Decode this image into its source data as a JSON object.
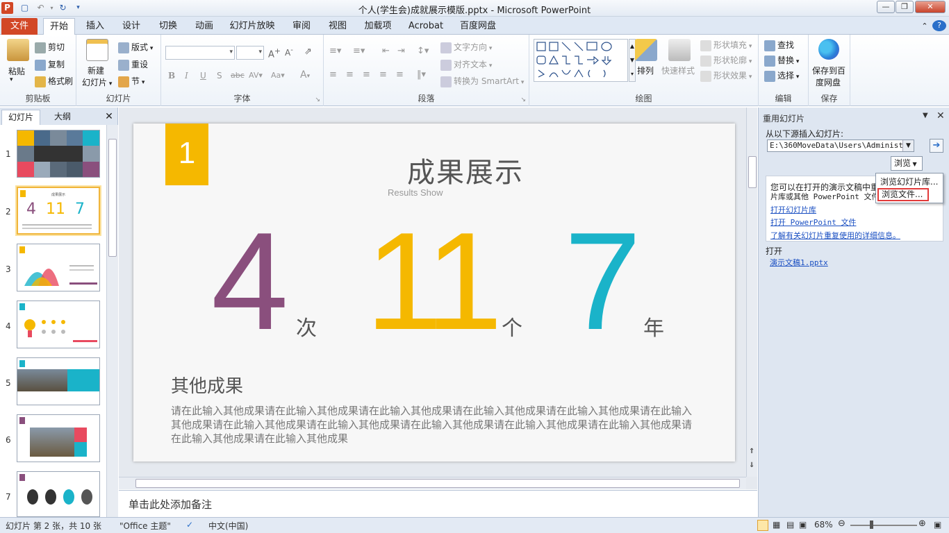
{
  "window": {
    "title": "个人(学生会)成就展示模版.pptx - Microsoft PowerPoint"
  },
  "tabs": [
    {
      "label": "文件"
    },
    {
      "label": "开始"
    },
    {
      "label": "插入"
    },
    {
      "label": "设计"
    },
    {
      "label": "切换"
    },
    {
      "label": "动画"
    },
    {
      "label": "幻灯片放映"
    },
    {
      "label": "审阅"
    },
    {
      "label": "视图"
    },
    {
      "label": "加载项"
    },
    {
      "label": "Acrobat"
    },
    {
      "label": "百度网盘"
    }
  ],
  "ribbon": {
    "clipboard": {
      "label": "剪贴板",
      "paste": "粘贴",
      "cut": "剪切",
      "copy": "复制",
      "format_painter": "格式刷"
    },
    "slides": {
      "label": "幻灯片",
      "new_slide_1": "新建",
      "new_slide_2": "幻灯片",
      "layout": "版式",
      "reset": "重设",
      "section": "节"
    },
    "font": {
      "label": "字体"
    },
    "paragraph": {
      "label": "段落",
      "text_direction": "文字方向",
      "align_text": "对齐文本",
      "convert_smartart": "转换为 SmartArt"
    },
    "drawing": {
      "label": "绘图",
      "arrange": "排列",
      "quick_styles": "快速样式",
      "shape_fill": "形状填充",
      "shape_outline": "形状轮廓",
      "shape_effects": "形状效果"
    },
    "editing": {
      "label": "编辑",
      "find": "查找",
      "replace": "替换",
      "select": "选择"
    },
    "save": {
      "label": "保存",
      "save_baidu_1": "保存到百",
      "save_baidu_2": "度网盘"
    }
  },
  "left_panel": {
    "tab_slides": "幻灯片",
    "tab_outline": "大纲",
    "thumb_numbers": [
      "1",
      "2",
      "3",
      "4",
      "5",
      "6",
      "7"
    ]
  },
  "slide": {
    "badge": "1",
    "title": "成果展示",
    "subtitle": "Results Show",
    "stats": [
      {
        "value": "4",
        "unit": "次",
        "color": "#8a4f7d"
      },
      {
        "value": "11",
        "unit": "个",
        "color": "#f5b800"
      },
      {
        "value": "7",
        "unit": "年",
        "color": "#1ab3c9"
      }
    ],
    "other_title": "其他成果",
    "other_text": "请在此输入其他成果请在此输入其他成果请在此输入其他成果请在此输入其他成果请在此输入其他成果请在此输入其他成果请在此输入其他成果请在此输入其他成果请在此输入其他成果请在此输入其他成果请在此输入其他成果请在此输入其他成果请在此输入其他成果",
    "badge_color": "#f5b800"
  },
  "notes": {
    "placeholder": "单击此处添加备注"
  },
  "reuse_panel": {
    "title": "重用幻灯片",
    "insert_from": "从以下源插入幻灯片:",
    "path": "E:\\360MoveData\\Users\\Administrato",
    "browse": "浏览",
    "menu_library": "浏览幻灯片库...",
    "menu_file": "浏览文件...",
    "info_1": "您可以在打开的演示文稿中重",
    "info_2": "片库或其他 PowerPoint 文件",
    "link_open_library": "打开幻灯片库",
    "link_open_ppt": "打开 PowerPoint 文件",
    "link_learn": "了解有关幻灯片重复使用的详细信息。",
    "open_label": "打开",
    "open_file": "演示文稿1.pptx"
  },
  "status": {
    "slide_info": "幻灯片 第 2 张，共 10 张",
    "theme": "\"Office 主题\"",
    "language": "中文(中国)",
    "zoom": "68%"
  }
}
